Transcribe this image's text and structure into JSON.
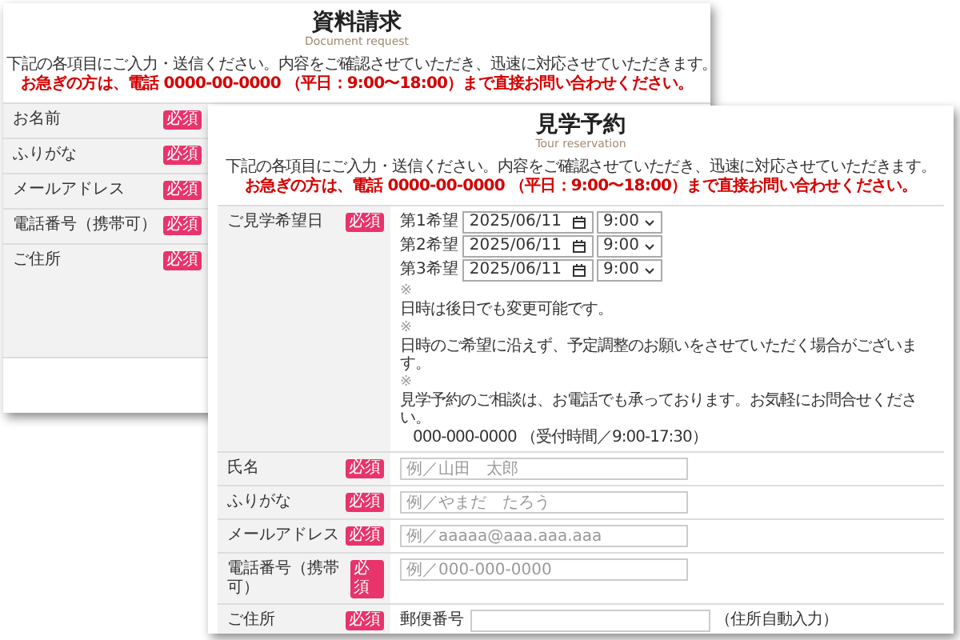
{
  "windows": [
    {
      "title": "資料請求",
      "subtitle": "Document request",
      "intro": "下記の各項目にご入力・送信ください。内容をご確認させていただき、迅速に対応させていただきます。",
      "notice": "お急ぎの方は、電話 0000-00-0000 （平日：9:00〜18:00）まで直接お問い合わせください。",
      "rows": [
        {
          "kind": "input",
          "label": "お名前",
          "badge": "必須"
        },
        {
          "kind": "input",
          "label": "ふりがな",
          "badge": "必須"
        },
        {
          "kind": "input",
          "label": "メールアドレス",
          "badge": "必須"
        },
        {
          "kind": "input",
          "label": "電話番号（携帯可）",
          "badge": "必須"
        },
        {
          "kind": "input",
          "label": "ご住所",
          "badge": "必須"
        }
      ]
    },
    {
      "title": "見学予約",
      "subtitle": "Tour reservation",
      "intro": "下記の各項目にご入力・送信ください。内容をご確認させていただき、迅速に対応させていただきます。",
      "notice": "お急ぎの方は、電話 0000-00-0000 （平日：9:00〜18:00）まで直接お問い合わせください。",
      "rows": [
        {
          "kind": "dates",
          "label": "ご見学希望日",
          "badge": "必須",
          "dates": [
            {
              "label": "第1希望",
              "date": "2025/06/11",
              "time": "9:00"
            },
            {
              "label": "第2希望",
              "date": "2025/06/11",
              "time": "9:00"
            },
            {
              "label": "第3希望",
              "date": "2025/06/11",
              "time": "9:00"
            }
          ],
          "notes": [
            {
              "mark": "※",
              "text": "日時は後日でも変更可能です。"
            },
            {
              "mark": "※",
              "text": "日時のご希望に沿えず、予定調整のお願いをさせていただく場合がございます。"
            },
            {
              "mark": "※",
              "text": "見学予約のご相談は、お電話でも承っております。お気軽にお問合せください。",
              "detail": "000-000-0000 （受付時間／9:00-17:30）"
            }
          ]
        },
        {
          "kind": "input",
          "label": "氏名",
          "badge": "必須",
          "placeholder": "例／山田　太郎"
        },
        {
          "kind": "input",
          "label": "ふりがな",
          "badge": "必須",
          "placeholder": "例／やまだ　たろう"
        },
        {
          "kind": "input",
          "label": "メールアドレス",
          "badge": "必須",
          "placeholder": "例／aaaaa@aaa.aaa.aaa"
        },
        {
          "kind": "input",
          "label": "電話番号（携帯可）",
          "badge": "必須",
          "placeholder": "例／000-000-0000"
        },
        {
          "kind": "address",
          "label": "ご住所",
          "badge": "必須",
          "fields": [
            {
              "label": "郵便番号",
              "hint": "（住所自動入力）"
            }
          ]
        }
      ]
    }
  ]
}
